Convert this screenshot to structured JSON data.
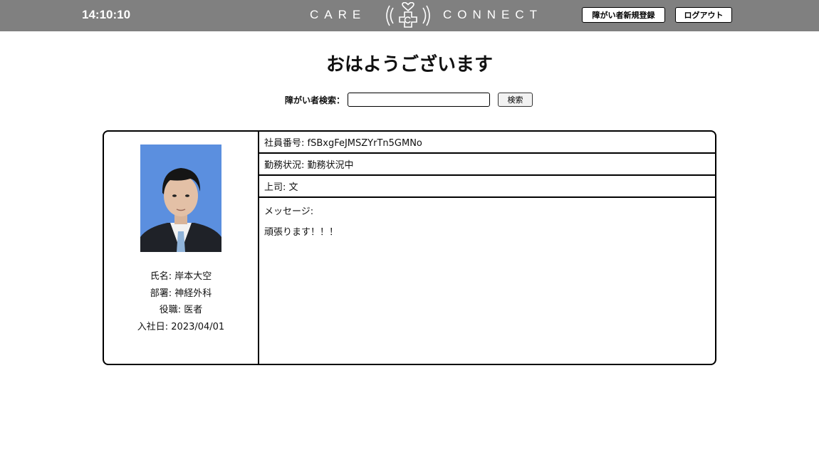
{
  "header": {
    "time": "14:10:10",
    "brand_left": "CARE",
    "brand_right": "CONNECT",
    "logo_icon": "heart-cross-signal-icon",
    "register_button": "障がい者新規登録",
    "logout_button": "ログアウト",
    "bar_color": "#808080"
  },
  "main": {
    "greeting": "おはようございます",
    "search": {
      "label": "障がい者検索：",
      "value": "",
      "placeholder": "",
      "button": "検索"
    }
  },
  "profile": {
    "photo_icon": "employee-photo",
    "name": "氏名: 岸本大空",
    "department": "部署: 神経外科",
    "position": "役職: 医者",
    "join_date": "入社日: 2023/04/01"
  },
  "details": {
    "employee_id": "社員番号: fSBxgFeJMSZYrTn5GMNo",
    "work_status": "勤務状況: 勤務状況中",
    "supervisor": "上司: 文",
    "message_label": "メッセージ:",
    "message_text": "頑張ります！！！"
  }
}
